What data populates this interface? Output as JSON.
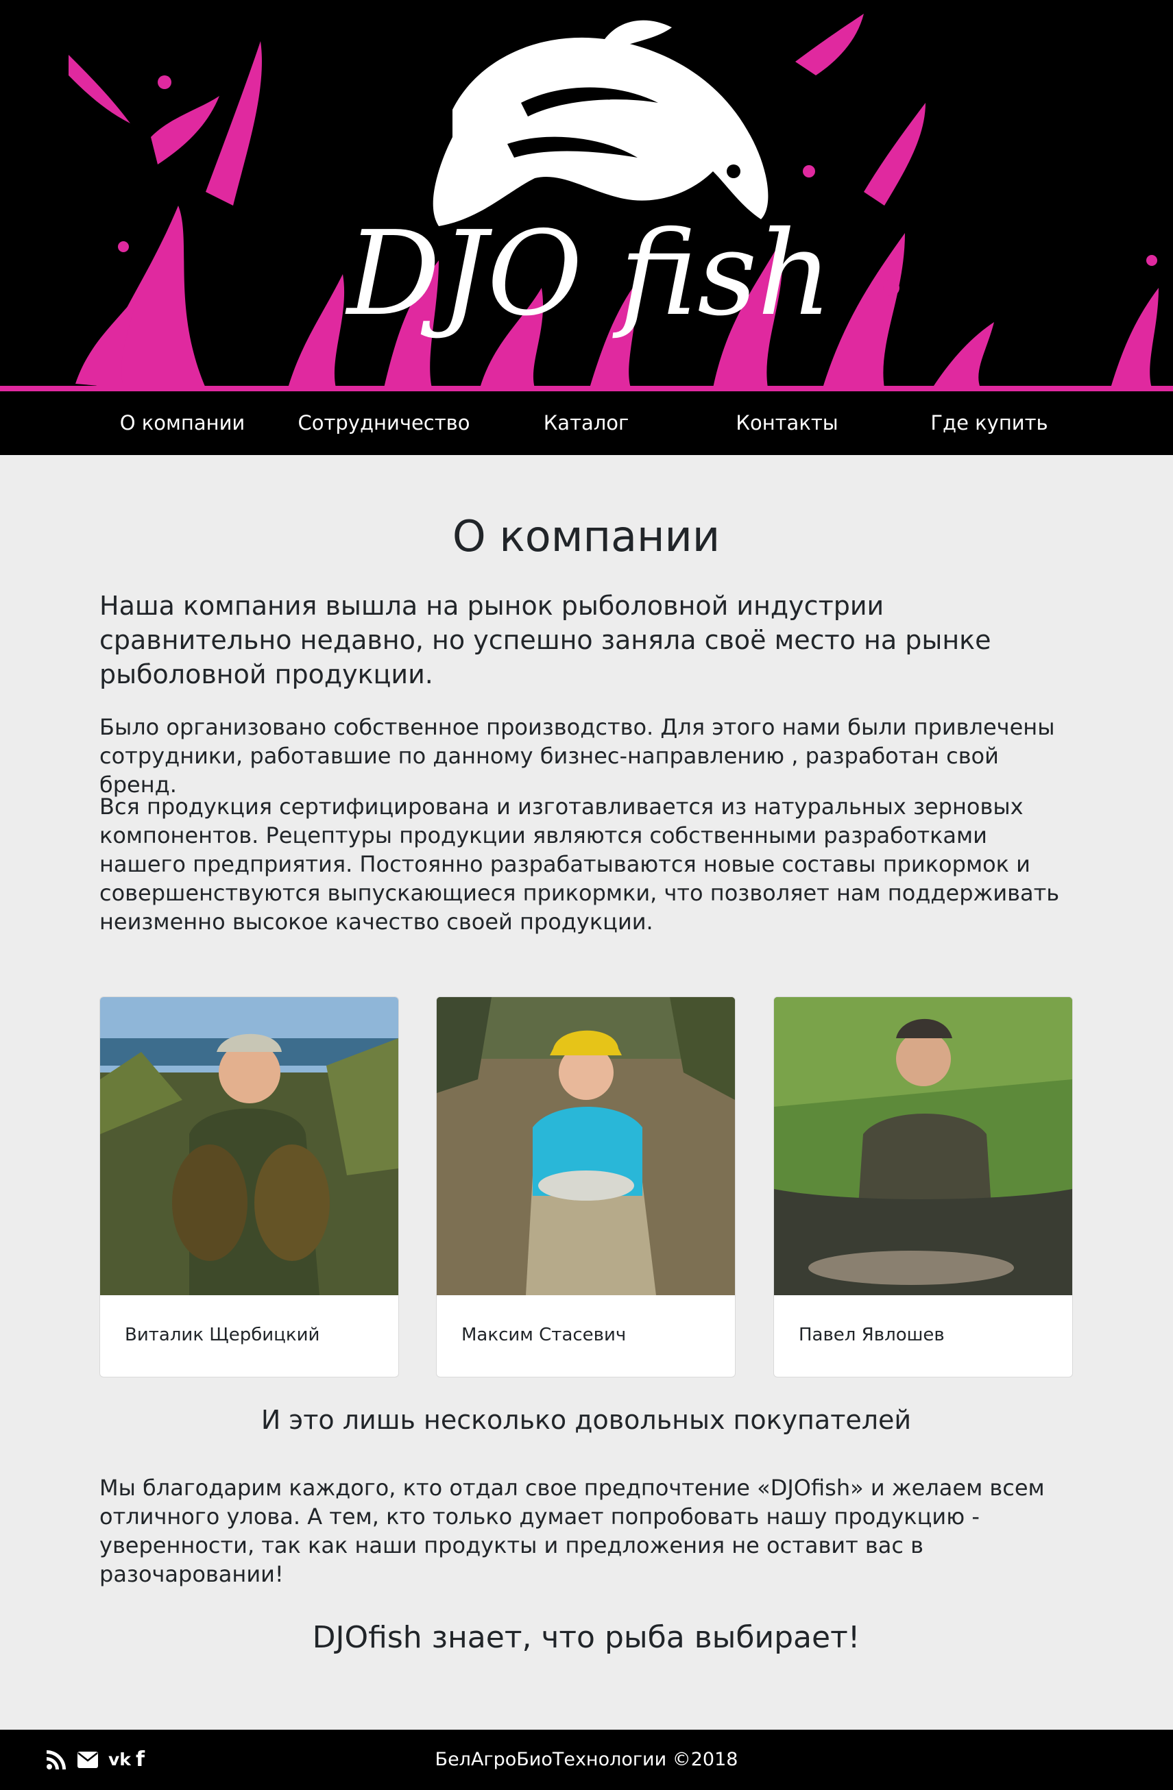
{
  "brand": {
    "logo_text": "DJO fish",
    "accent_color": "#e0299f"
  },
  "nav": {
    "items": [
      {
        "label": "О компании"
      },
      {
        "label": "Сотрудничество"
      },
      {
        "label": "Каталог"
      },
      {
        "label": "Контакты"
      },
      {
        "label": "Где купить"
      }
    ]
  },
  "about": {
    "title": "О компании",
    "lead": "Наша компания вышла на рынок рыболовной индустрии сравнительно недавно, но успешно заняла своё место на рынке рыболовной продукции.",
    "p1": "Было организовано собственное производство. Для этого нами были привлечены сотрудники, работавшие по данному бизнес-направлению , разработан свой бренд.",
    "p2": "Вся продукция сертифицирована и изготавливается из натуральных зерновых компонентов. Рецептуры продукции являются собственными разработками нашего предприятия. Постоянно разрабатываются новые составы прикормок и совершенствуются выпускающиеся прикормки, что позволяет нам поддерживать неизменно высокое качество своей продукции."
  },
  "customers": [
    {
      "name": "Виталик Щербицкий"
    },
    {
      "name": "Максим Стасевич"
    },
    {
      "name": "Павел Явлошев"
    }
  ],
  "testimonial": {
    "subtitle": "И это лишь несколько довольных покупателей",
    "text": "Мы благодарим каждого, кто отдал свое предпочтение «DJOfish» и желаем всем отличного улова. А тем, кто только думает попробовать нашу продукцию - уверенности, так как наши продукты и предложения не оставит вас в разочаровании!",
    "slogan": "DJOfish знает, что рыба выбирает!"
  },
  "footer": {
    "icons": [
      "rss-icon",
      "envelope-icon",
      "vk-icon",
      "facebook-icon"
    ],
    "copyright": "БелАгроБиоТехнологии ©2018"
  }
}
